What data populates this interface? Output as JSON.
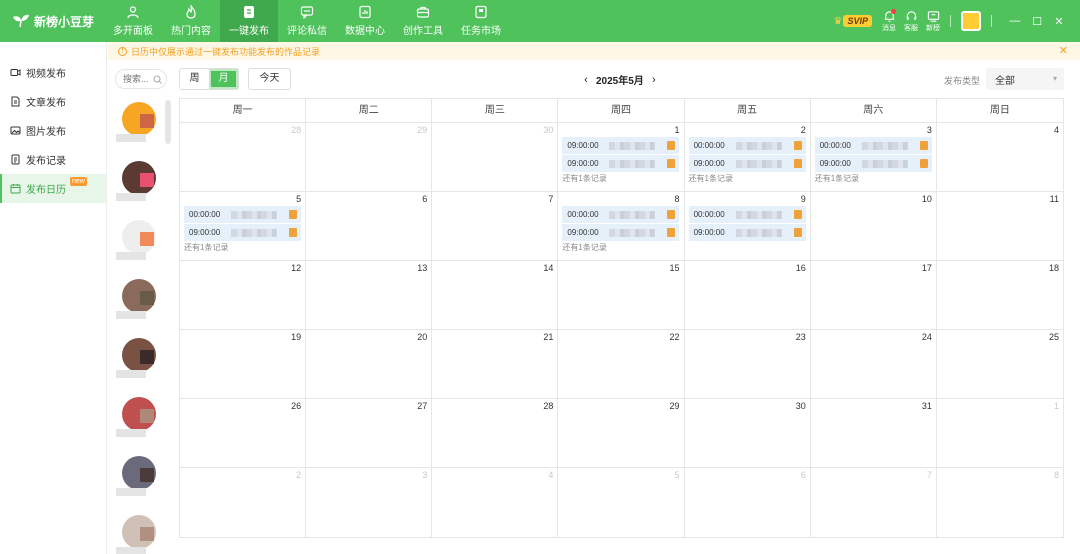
{
  "app": {
    "brand": "新榜小豆芽"
  },
  "nav": [
    {
      "label": "多开面板",
      "icon": "person-icon",
      "active": false
    },
    {
      "label": "热门内容",
      "icon": "flame-icon",
      "active": false
    },
    {
      "label": "一键发布",
      "icon": "publish-icon",
      "active": true
    },
    {
      "label": "评论私信",
      "icon": "chat-icon",
      "active": false
    },
    {
      "label": "数据中心",
      "icon": "data-icon",
      "active": false
    },
    {
      "label": "创作工具",
      "icon": "toolbox-icon",
      "active": false
    },
    {
      "label": "任务市场",
      "icon": "flag-icon",
      "active": false
    }
  ],
  "topright": {
    "svip": "SVIP",
    "message": "消息",
    "service": "客服",
    "news": "新榜"
  },
  "sidebar": [
    {
      "label": "视频发布",
      "icon": "video-icon",
      "active": false
    },
    {
      "label": "文章发布",
      "icon": "article-icon",
      "active": false
    },
    {
      "label": "图片发布",
      "icon": "image-icon",
      "active": false
    },
    {
      "label": "发布记录",
      "icon": "record-icon",
      "active": false
    },
    {
      "label": "发布日历",
      "icon": "calendar-icon",
      "active": true,
      "badge": "new"
    }
  ],
  "notice": {
    "text": "日历中仅展示通过一键发布功能发布的作品记录",
    "close": "✕"
  },
  "search": {
    "placeholder": "搜索..."
  },
  "view_toggle": {
    "week": "周",
    "month": "月",
    "selected": "月"
  },
  "today": "今天",
  "month_label": "2025年5月",
  "publish_type": {
    "label": "发布类型",
    "value": "全部"
  },
  "weekdays": [
    "周一",
    "周二",
    "周三",
    "周四",
    "周五",
    "周六",
    "周日"
  ],
  "accounts": [
    {
      "color": "#f6a623",
      "accent": "#cc6644"
    },
    {
      "color": "#5a3a32",
      "accent": "#e85070"
    },
    {
      "color": "#eeeeee",
      "accent": "#f08a5a"
    },
    {
      "color": "#8a6a5a",
      "accent": "#6a5a4a"
    },
    {
      "color": "#7a5244",
      "accent": "#3a2a2a"
    },
    {
      "color": "#c05050",
      "accent": "#b08878"
    },
    {
      "color": "#6a6a7a",
      "accent": "#4a3a3a"
    },
    {
      "color": "#d0c0b8",
      "accent": "#b09080"
    }
  ],
  "weeks": [
    [
      {
        "d": "28",
        "other": true
      },
      {
        "d": "29",
        "other": true
      },
      {
        "d": "30",
        "other": true
      },
      {
        "d": "1",
        "events": [
          "09:00:00",
          "09:00:00"
        ],
        "more": "还有1条记录"
      },
      {
        "d": "2",
        "events": [
          "00:00:00",
          "09:00:00"
        ],
        "more": "还有1条记录"
      },
      {
        "d": "3",
        "events": [
          "00:00:00",
          "09:00:00"
        ],
        "more": "还有1条记录"
      },
      {
        "d": "4"
      }
    ],
    [
      {
        "d": "5",
        "events": [
          "00:00:00",
          "09:00:00"
        ],
        "more": "还有1条记录"
      },
      {
        "d": "6"
      },
      {
        "d": "7"
      },
      {
        "d": "8",
        "events": [
          "00:00:00",
          "09:00:00"
        ],
        "more": "还有1条记录"
      },
      {
        "d": "9",
        "events": [
          "00:00:00",
          "09:00:00"
        ]
      },
      {
        "d": "10"
      },
      {
        "d": "11"
      }
    ],
    [
      {
        "d": "12"
      },
      {
        "d": "13"
      },
      {
        "d": "14"
      },
      {
        "d": "15"
      },
      {
        "d": "16"
      },
      {
        "d": "17"
      },
      {
        "d": "18"
      }
    ],
    [
      {
        "d": "19"
      },
      {
        "d": "20"
      },
      {
        "d": "21"
      },
      {
        "d": "22"
      },
      {
        "d": "23"
      },
      {
        "d": "24"
      },
      {
        "d": "25"
      }
    ],
    [
      {
        "d": "26"
      },
      {
        "d": "27"
      },
      {
        "d": "28"
      },
      {
        "d": "29"
      },
      {
        "d": "30"
      },
      {
        "d": "31"
      },
      {
        "d": "1",
        "other": true
      }
    ],
    [
      {
        "d": "2",
        "other": true
      },
      {
        "d": "3",
        "other": true
      },
      {
        "d": "4",
        "other": true
      },
      {
        "d": "5",
        "other": true
      },
      {
        "d": "6",
        "other": true
      },
      {
        "d": "7",
        "other": true
      },
      {
        "d": "8",
        "other": true
      }
    ]
  ],
  "colors": {
    "brand_green": "#4fc25c",
    "event_bg": "#e6f0fb",
    "notice_text": "#f0a020"
  }
}
